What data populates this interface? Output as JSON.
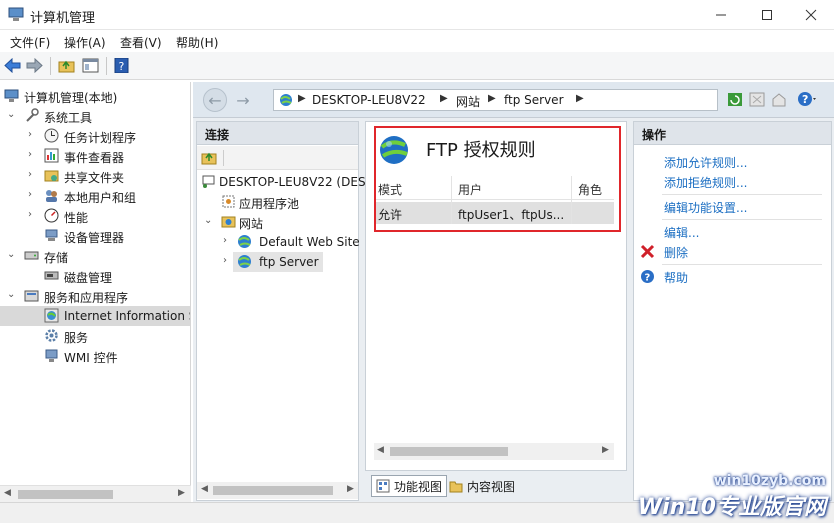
{
  "window": {
    "title": "计算机管理"
  },
  "menu": [
    "文件(F)",
    "操作(A)",
    "查看(V)",
    "帮助(H)"
  ],
  "tree": {
    "root": "计算机管理(本地)",
    "system_tools": "系统工具",
    "task_scheduler": "任务计划程序",
    "event_viewer": "事件查看器",
    "shared_folders": "共享文件夹",
    "local_users": "本地用户和组",
    "performance": "性能",
    "device_manager": "设备管理器",
    "storage": "存储",
    "disk_management": "磁盘管理",
    "services_apps": "服务和应用程序",
    "iis": "Internet Information S",
    "services": "服务",
    "wmi": "WMI 控件"
  },
  "address": {
    "parts": [
      "DESKTOP-LEU8V22",
      "网站",
      "ftp Server"
    ]
  },
  "connections": {
    "header": "连接",
    "server": "DESKTOP-LEU8V22 (DES",
    "app_pools": "应用程序池",
    "sites": "网站",
    "site1": "Default Web Site",
    "site2": "ftp Server"
  },
  "feature": {
    "title": "FTP 授权规则",
    "columns": [
      "模式",
      "用户",
      "角色"
    ],
    "row": {
      "mode": "允许",
      "users": "ftpUser1、ftpUs..."
    }
  },
  "view_tabs": {
    "features": "功能视图",
    "content": "内容视图"
  },
  "actions": {
    "header": "操作",
    "add_allow": "添加允许规则...",
    "add_deny": "添加拒绝规则...",
    "edit_settings": "编辑功能设置...",
    "edit": "编辑...",
    "delete": "删除",
    "help": "帮助"
  },
  "watermark": {
    "url": "win10zyb.com",
    "brand": "Win10专业版官网"
  },
  "colors": {
    "highlight_border": "#e0262b",
    "link": "#1b6ec2"
  }
}
